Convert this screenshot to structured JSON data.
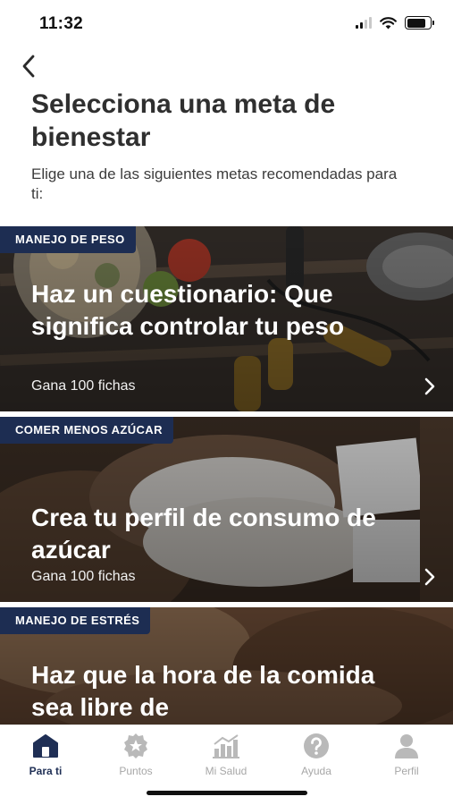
{
  "status": {
    "time": "11:32"
  },
  "header": {
    "title": "Selecciona una meta de bienestar",
    "subtitle": "Elige una de las siguientes metas recomendadas para ti:"
  },
  "cards": [
    {
      "tag": "MANEJO DE PESO",
      "title": "Haz un cuestionario: Que significa controlar tu peso",
      "reward": "Gana 100 fichas"
    },
    {
      "tag": "COMER MENOS AZÚCAR",
      "title": "Crea tu perfil de consumo de azúcar",
      "reward": "Gana 100 fichas"
    },
    {
      "tag": "MANEJO DE ESTRÉS",
      "title": "Haz que la hora de la comida sea libre de"
    }
  ],
  "tabs": [
    {
      "label": "Para ti",
      "icon": "home-icon",
      "active": true
    },
    {
      "label": "Puntos",
      "icon": "star-badge-icon"
    },
    {
      "label": "Mi Salud",
      "icon": "bar-chart-icon"
    },
    {
      "label": "Ayuda",
      "icon": "help-icon"
    },
    {
      "label": "Perfil",
      "icon": "person-icon"
    }
  ],
  "colors": {
    "tag_bg": "#1d2d52",
    "active_tab": "#1f2f55",
    "inactive_tab": "#a7a7a7"
  }
}
